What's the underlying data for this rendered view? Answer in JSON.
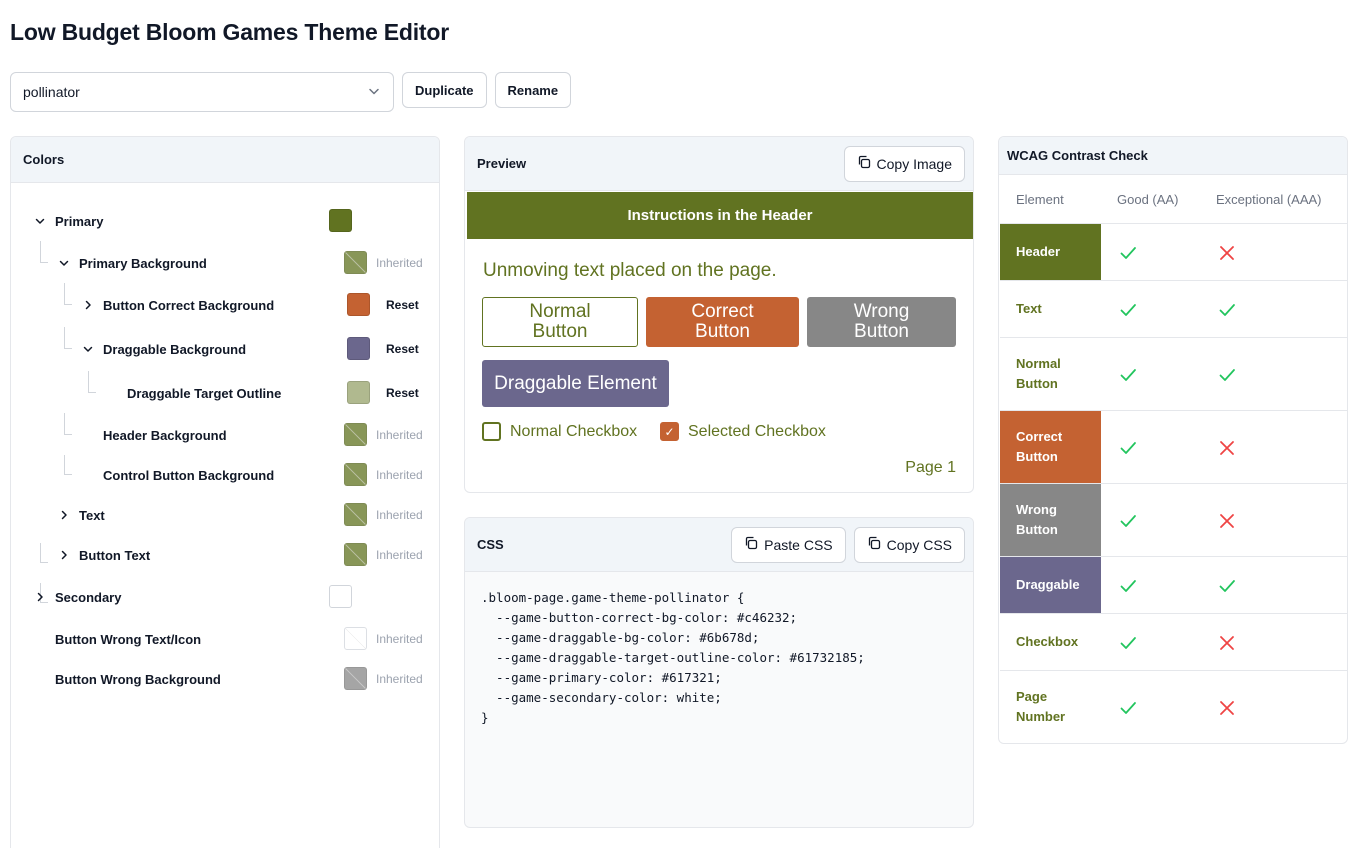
{
  "app_title": "Low Budget Bloom Games Theme Editor",
  "theme_select": {
    "value": "pollinator"
  },
  "toolbar": {
    "duplicate_label": "Duplicate",
    "rename_label": "Rename"
  },
  "colors_panel": {
    "title": "Colors",
    "inherited_label": "Inherited",
    "reset_label": "Reset",
    "items": [
      {
        "label": "Primary",
        "color": "#617321",
        "state": "own",
        "expander": "open"
      },
      {
        "label": "Primary Background",
        "color": "#617321",
        "state": "inherited",
        "expander": "open"
      },
      {
        "label": "Button Correct Background",
        "color": "#c46232",
        "state": "reset",
        "expander": "closed"
      },
      {
        "label": "Draggable Background",
        "color": "#6b678d",
        "state": "reset",
        "expander": "open"
      },
      {
        "label": "Draggable Target Outline",
        "color": "#b0b98f",
        "state": "reset",
        "expander": "none"
      },
      {
        "label": "Header Background",
        "color": "#617321",
        "state": "inherited",
        "expander": "none"
      },
      {
        "label": "Control Button Background",
        "color": "#617321",
        "state": "inherited",
        "expander": "none"
      },
      {
        "label": "Text",
        "color": "#617321",
        "state": "inherited",
        "expander": "closed"
      },
      {
        "label": "Button Text",
        "color": "#617321",
        "state": "inherited",
        "expander": "closed"
      },
      {
        "label": "Secondary",
        "color": "#ffffff",
        "state": "own",
        "expander": "closed"
      },
      {
        "label": "Button Wrong Text/Icon",
        "color": "#ffffff",
        "state": "inherited",
        "expander": "none"
      },
      {
        "label": "Button Wrong Background",
        "color": "#878787",
        "state": "inherited",
        "expander": "none"
      }
    ]
  },
  "preview_panel": {
    "title": "Preview",
    "copy_image_label": "Copy Image",
    "header_text": "Instructions in the Header",
    "body_text": "Unmoving text placed on the page.",
    "normal_button": "Normal\nButton",
    "correct_button": "Correct\nButton",
    "wrong_button": "Wrong\nButton",
    "draggable_label": "Draggable Element",
    "normal_checkbox": "Normal Checkbox",
    "selected_checkbox": "Selected Checkbox",
    "page_number": "Page 1",
    "check_glyph": "✓"
  },
  "css_panel": {
    "title": "CSS",
    "paste_label": "Paste CSS",
    "copy_label": "Copy CSS",
    "code": ".bloom-page.game-theme-pollinator {\n  --game-button-correct-bg-color: #c46232;\n  --game-draggable-bg-color: #6b678d;\n  --game-draggable-target-outline-color: #61732185;\n  --game-primary-color: #617321;\n  --game-secondary-color: white;\n}"
  },
  "wcag_panel": {
    "title": "WCAG Contrast Check",
    "headers": {
      "element": "Element",
      "aa": "Good (AA)",
      "aaa": "Exceptional (AAA)"
    },
    "rows": [
      {
        "label": "Header",
        "bg": "#617321",
        "fg": "#ffffff",
        "aa": "pass",
        "aaa": "fail"
      },
      {
        "label": "Text",
        "bg": "#ffffff",
        "fg": "#617321",
        "aa": "pass",
        "aaa": "pass"
      },
      {
        "label": "Normal\nButton",
        "bg": "#ffffff",
        "fg": "#617321",
        "aa": "pass",
        "aaa": "pass"
      },
      {
        "label": "Correct\nButton",
        "bg": "#c46232",
        "fg": "#ffffff",
        "aa": "pass",
        "aaa": "fail"
      },
      {
        "label": "Wrong\nButton",
        "bg": "#878787",
        "fg": "#ffffff",
        "aa": "pass",
        "aaa": "fail"
      },
      {
        "label": "Draggable",
        "bg": "#6b678d",
        "fg": "#ffffff",
        "aa": "pass",
        "aaa": "pass"
      },
      {
        "label": "Checkbox",
        "bg": "#ffffff",
        "fg": "#617321",
        "aa": "pass",
        "aaa": "fail"
      },
      {
        "label": "Page\nNumber",
        "bg": "#ffffff",
        "fg": "#617321",
        "aa": "pass",
        "aaa": "fail"
      }
    ]
  },
  "theme_colors": {
    "primary": "#617321",
    "correct": "#c46232",
    "wrong": "#878787",
    "draggable": "#6b678d",
    "pass": "#22c55e",
    "fail": "#ef4444"
  },
  "icons": {
    "dropdown": "chevron-down-icon",
    "copy": "copy-icon",
    "pass": "check-icon",
    "fail": "x-icon"
  }
}
